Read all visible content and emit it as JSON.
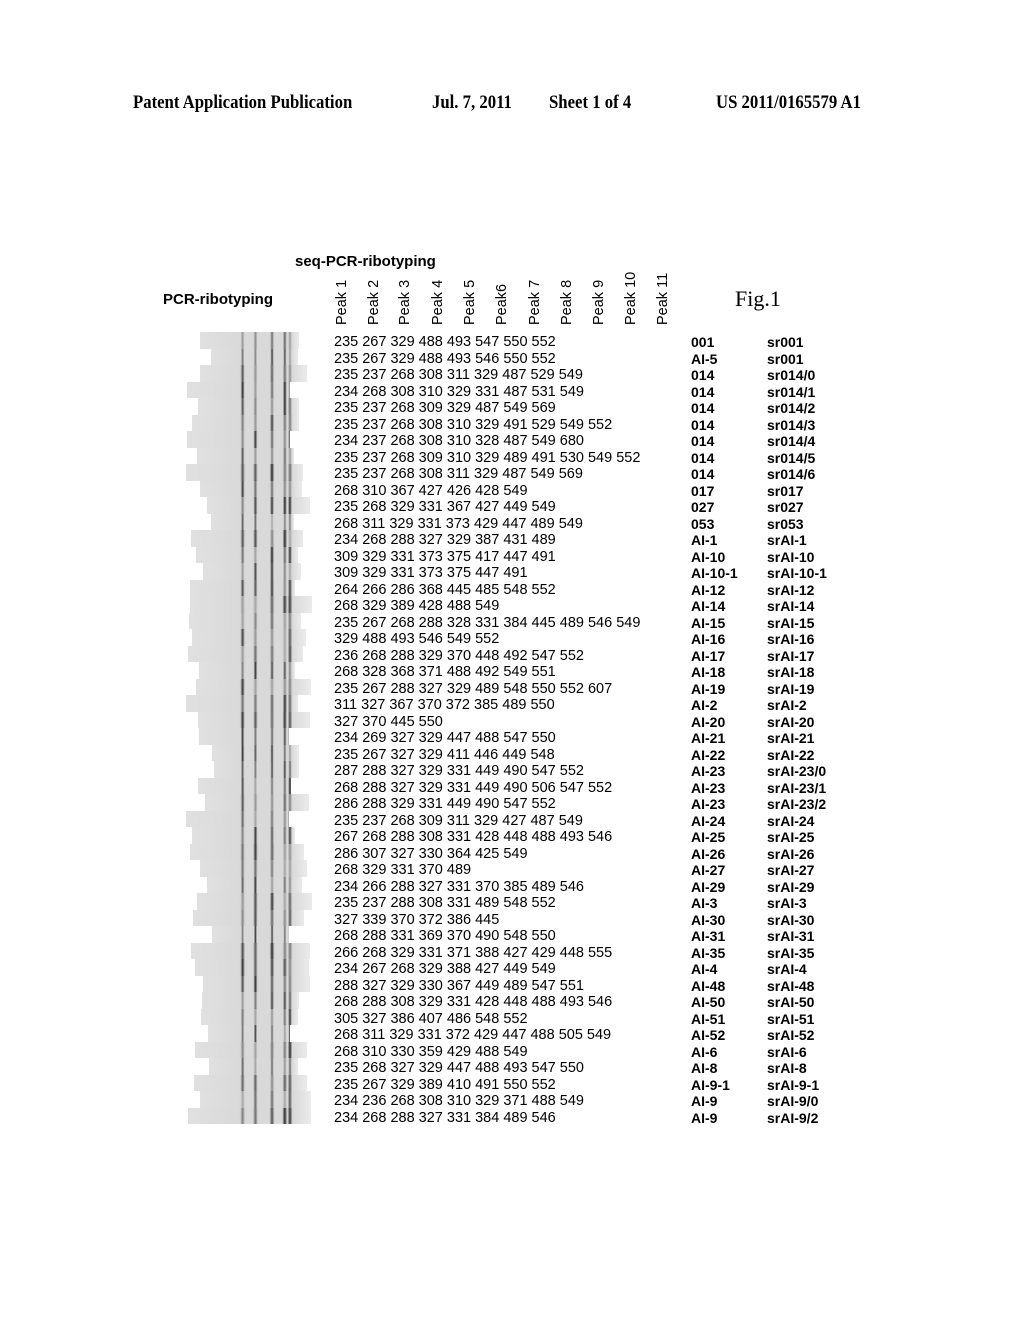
{
  "header": {
    "publication": "Patent Application Publication",
    "date": "Jul. 7, 2011",
    "sheet": "Sheet 1 of 4",
    "number": "US 2011/0165579 A1"
  },
  "figure": {
    "label": "Fig.1",
    "seq_title": "seq-PCR-ribotyping",
    "pcr_title": "PCR-ribotyping",
    "peak_headers": [
      "Peak 1",
      "Peak 2",
      "Peak 3",
      "Peak 4",
      "Peak 5",
      "Peak6",
      "Peak 7",
      "Peak 8",
      "Peak 9",
      "Peak 10",
      "Peak 11"
    ],
    "gel_image": "PCR-ribotyping gel band pattern image"
  },
  "rows": [
    {
      "peaks": "235 267 329 488 493 547 550 552",
      "pcr": "001",
      "sr": "sr001"
    },
    {
      "peaks": "235 267 329 488 493 546 550 552",
      "pcr": "AI-5",
      "sr": "sr001"
    },
    {
      "peaks": "235 237 268 308 311 329 487 529 549",
      "pcr": "014",
      "sr": "sr014/0"
    },
    {
      "peaks": "234 268 308 310 329 331 487 531 549",
      "pcr": "014",
      "sr": "sr014/1"
    },
    {
      "peaks": "235 237 268 309 329 487 549 569",
      "pcr": "014",
      "sr": "sr014/2"
    },
    {
      "peaks": "235 237 268 308 310 329 491 529 549 552",
      "pcr": "014",
      "sr": "sr014/3"
    },
    {
      "peaks": "234 237 268 308 310 328 487 549 680",
      "pcr": "014",
      "sr": "sr014/4"
    },
    {
      "peaks": "235 237 268 309 310 329 489 491 530 549 552",
      "pcr": "014",
      "sr": "sr014/5"
    },
    {
      "peaks": "235 237 268 308 311 329 487 549 569",
      "pcr": "014",
      "sr": "sr014/6"
    },
    {
      "peaks": "268 310 367 427 426 428 549",
      "pcr": "017",
      "sr": "sr017"
    },
    {
      "peaks": "235 268 329 331 367 427 449 549",
      "pcr": "027",
      "sr": "sr027"
    },
    {
      "peaks": "268 311 329 331 373 429 447 489 549",
      "pcr": "053",
      "sr": "sr053"
    },
    {
      "peaks": "234 268 288 327 329 387 431 489",
      "pcr": "AI-1",
      "sr": "srAI-1"
    },
    {
      "peaks": "309 329 331 373 375 417 447 491",
      "pcr": "AI-10",
      "sr": "srAI-10"
    },
    {
      "peaks": "309 329 331 373 375 447 491",
      "pcr": "AI-10-1",
      "sr": "srAI-10-1"
    },
    {
      "peaks": "264 266 286 368 445 485 548 552",
      "pcr": "AI-12",
      "sr": "srAI-12"
    },
    {
      "peaks": "268 329 389 428 488 549",
      "pcr": "AI-14",
      "sr": "srAI-14"
    },
    {
      "peaks": "235 267 268 288 328 331 384 445 489 546 549",
      "pcr": "AI-15",
      "sr": "srAI-15"
    },
    {
      "peaks": "329 488 493 546 549 552",
      "pcr": "AI-16",
      "sr": "srAI-16"
    },
    {
      "peaks": "236 268 288 329 370 448 492 547 552",
      "pcr": "AI-17",
      "sr": "srAI-17"
    },
    {
      "peaks": "268 328 368 371 488 492 549 551",
      "pcr": "AI-18",
      "sr": "srAI-18"
    },
    {
      "peaks": "235 267 288 327 329 489 548 550 552 607",
      "pcr": "AI-19",
      "sr": "srAI-19"
    },
    {
      "peaks": "311 327 367 370 372 385 489 550",
      "pcr": "AI-2",
      "sr": "srAI-2"
    },
    {
      "peaks": "327 370 445 550",
      "pcr": "AI-20",
      "sr": "srAI-20"
    },
    {
      "peaks": "234 269 327 329 447 488 547 550",
      "pcr": "AI-21",
      "sr": "srAI-21"
    },
    {
      "peaks": "235 267 327 329 411 446 449 548",
      "pcr": "AI-22",
      "sr": "srAI-22"
    },
    {
      "peaks": "287 288 327 329 331 449 490 547 552",
      "pcr": "AI-23",
      "sr": "srAI-23/0"
    },
    {
      "peaks": "268 288 327 329 331 449 490 506 547 552",
      "pcr": "AI-23",
      "sr": "srAI-23/1"
    },
    {
      "peaks": "286 288 329 331 449 490 547 552",
      "pcr": "AI-23",
      "sr": "srAI-23/2"
    },
    {
      "peaks": "235 237 268 309 311 329 427 487 549",
      "pcr": "AI-24",
      "sr": "srAI-24"
    },
    {
      "peaks": "267 268 288 308 331 428 448 488 493 546",
      "pcr": "AI-25",
      "sr": "srAI-25"
    },
    {
      "peaks": "286 307 327 330 364 425 549",
      "pcr": "AI-26",
      "sr": "srAI-26"
    },
    {
      "peaks": "268 329 331 370 489",
      "pcr": "AI-27",
      "sr": "srAI-27"
    },
    {
      "peaks": "234 266 288 327 331 370 385 489 546",
      "pcr": "AI-29",
      "sr": "srAI-29"
    },
    {
      "peaks": "235 237 288 308 331 489 548 552",
      "pcr": "AI-3",
      "sr": "srAI-3"
    },
    {
      "peaks": "327 339 370 372 386 445",
      "pcr": "AI-30",
      "sr": "srAI-30"
    },
    {
      "peaks": "268 288 331 369 370 490 548 550",
      "pcr": "AI-31",
      "sr": "srAI-31"
    },
    {
      "peaks": "266 268 329 331 371 388 427 429 448 555",
      "pcr": "AI-35",
      "sr": "srAI-35"
    },
    {
      "peaks": "234 267 268 329 388 427 449 549",
      "pcr": "AI-4",
      "sr": "srAI-4"
    },
    {
      "peaks": "288 327 329 330 367 449 489 547 551",
      "pcr": "AI-48",
      "sr": "srAI-48"
    },
    {
      "peaks": "268 288 308 329 331 428 448 488 493 546",
      "pcr": "AI-50",
      "sr": "srAI-50"
    },
    {
      "peaks": "305 327 386 407 486 548 552",
      "pcr": "AI-51",
      "sr": "srAI-51"
    },
    {
      "peaks": "268 311 329 331 372 429 447 488 505 549",
      "pcr": "AI-52",
      "sr": "srAI-52"
    },
    {
      "peaks": "268 310 330 359 429 488 549",
      "pcr": "AI-6",
      "sr": "srAI-6"
    },
    {
      "peaks": "235 268 327 329 447 488 493 547 550",
      "pcr": "AI-8",
      "sr": "srAI-8"
    },
    {
      "peaks": "235 267 329 389 410 491 550 552",
      "pcr": "AI-9-1",
      "sr": "srAI-9-1"
    },
    {
      "peaks": "234 236 268 308 310 329 371 488 549",
      "pcr": "AI-9",
      "sr": "srAI-9/0"
    },
    {
      "peaks": "234 268 288 327 331 384 489 546",
      "pcr": "AI-9",
      "sr": "srAI-9/2"
    }
  ]
}
